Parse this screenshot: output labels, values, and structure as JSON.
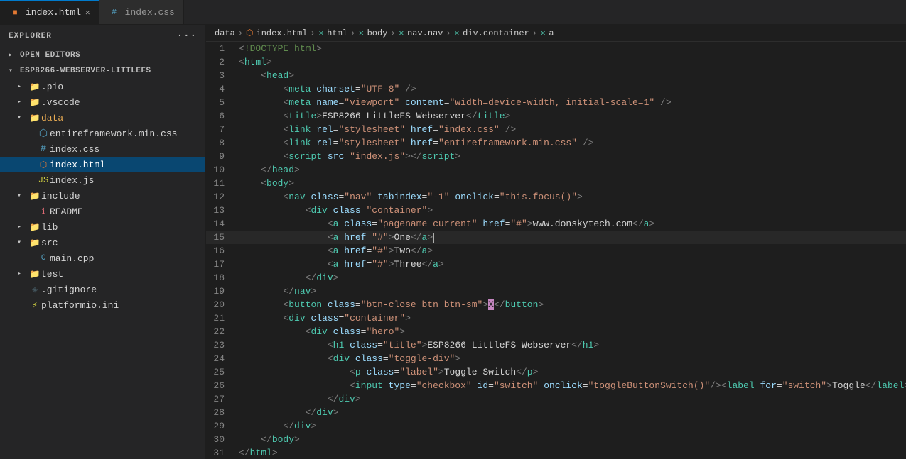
{
  "tabs": [
    {
      "label": "index.html",
      "type": "html",
      "active": true,
      "id": "tab-indexhtml"
    },
    {
      "label": "index.css",
      "type": "css",
      "active": false,
      "id": "tab-indexcss"
    }
  ],
  "breadcrumb": {
    "items": [
      "data",
      "index.html",
      "html",
      "body",
      "nav.nav",
      "div.container",
      "a"
    ]
  },
  "sidebar": {
    "title": "EXPLORER",
    "openEditors": "OPEN EDITORS",
    "projectRoot": "ESP8266-WEBSERVER-LITTLEFS",
    "files": [
      {
        "id": "pio",
        "label": ".pio",
        "type": "folder",
        "indent": 1,
        "expanded": false
      },
      {
        "id": "vscode",
        "label": ".vscode",
        "type": "folder",
        "indent": 1,
        "expanded": false
      },
      {
        "id": "data",
        "label": "data",
        "type": "folder",
        "indent": 1,
        "expanded": true
      },
      {
        "id": "entireframework",
        "label": "entireframework.min.css",
        "type": "css",
        "indent": 2
      },
      {
        "id": "indexcss",
        "label": "index.css",
        "type": "css",
        "indent": 2
      },
      {
        "id": "indexhtml",
        "label": "index.html",
        "type": "html",
        "indent": 2,
        "active": true
      },
      {
        "id": "indexjs",
        "label": "index.js",
        "type": "js",
        "indent": 2
      },
      {
        "id": "include",
        "label": "include",
        "type": "folder",
        "indent": 1,
        "expanded": true
      },
      {
        "id": "readme",
        "label": "README",
        "type": "readme",
        "indent": 2
      },
      {
        "id": "lib",
        "label": "lib",
        "type": "folder",
        "indent": 1,
        "expanded": false
      },
      {
        "id": "src",
        "label": "src",
        "type": "folder",
        "indent": 1,
        "expanded": true
      },
      {
        "id": "maincpp",
        "label": "main.cpp",
        "type": "cpp",
        "indent": 2
      },
      {
        "id": "test",
        "label": "test",
        "type": "folder",
        "indent": 1,
        "expanded": false
      },
      {
        "id": "gitignore",
        "label": ".gitignore",
        "type": "gitignore",
        "indent": 1
      },
      {
        "id": "platformio",
        "label": "platformio.ini",
        "type": "ini",
        "indent": 1
      }
    ]
  },
  "code": {
    "lines": [
      {
        "num": 1,
        "html": "<span class='t-bracket'>&lt;</span><span class='t-doctype'>!DOCTYPE html</span><span class='t-bracket'>&gt;</span>"
      },
      {
        "num": 2,
        "html": "<span class='t-bracket'>&lt;</span><span class='t-tag'>html</span><span class='t-bracket'>&gt;</span>"
      },
      {
        "num": 3,
        "html": "    <span class='t-bracket'>&lt;</span><span class='t-tag'>head</span><span class='t-bracket'>&gt;</span>"
      },
      {
        "num": 4,
        "html": "        <span class='t-bracket'>&lt;</span><span class='t-tag'>meta</span> <span class='t-attr'>charset</span><span class='t-eq'>=</span><span class='t-val'>\"UTF-8\"</span> <span class='t-bracket'>/&gt;</span>"
      },
      {
        "num": 5,
        "html": "        <span class='t-bracket'>&lt;</span><span class='t-tag'>meta</span> <span class='t-attr'>name</span><span class='t-eq'>=</span><span class='t-val'>\"viewport\"</span> <span class='t-attr'>content</span><span class='t-eq'>=</span><span class='t-val'>\"width=device-width, initial-scale=1\"</span> <span class='t-bracket'>/&gt;</span>"
      },
      {
        "num": 6,
        "html": "        <span class='t-bracket'>&lt;</span><span class='t-tag'>title</span><span class='t-bracket'>&gt;</span><span class='t-text'>ESP8266 LittleFS Webserver</span><span class='t-bracket'>&lt;/</span><span class='t-tag'>title</span><span class='t-bracket'>&gt;</span>"
      },
      {
        "num": 7,
        "html": "        <span class='t-bracket'>&lt;</span><span class='t-tag'>link</span> <span class='t-attr'>rel</span><span class='t-eq'>=</span><span class='t-val'>\"stylesheet\"</span> <span class='t-attr'>href</span><span class='t-eq'>=</span><span class='t-val'>\"index.css\"</span> <span class='t-bracket'>/&gt;</span>"
      },
      {
        "num": 8,
        "html": "        <span class='t-bracket'>&lt;</span><span class='t-tag'>link</span> <span class='t-attr'>rel</span><span class='t-eq'>=</span><span class='t-val'>\"stylesheet\"</span> <span class='t-attr'>href</span><span class='t-eq'>=</span><span class='t-val'>\"entireframework.min.css\"</span> <span class='t-bracket'>/&gt;</span>"
      },
      {
        "num": 9,
        "html": "        <span class='t-bracket'>&lt;</span><span class='t-tag'>script</span> <span class='t-attr'>src</span><span class='t-eq'>=</span><span class='t-val'>\"index.js\"</span><span class='t-bracket'>&gt;&lt;/</span><span class='t-tag'>script</span><span class='t-bracket'>&gt;</span>"
      },
      {
        "num": 10,
        "html": "    <span class='t-bracket'>&lt;/</span><span class='t-tag'>head</span><span class='t-bracket'>&gt;</span>"
      },
      {
        "num": 11,
        "html": "    <span class='t-bracket'>&lt;</span><span class='t-tag'>body</span><span class='t-bracket'>&gt;</span>"
      },
      {
        "num": 12,
        "html": "        <span class='t-bracket'>&lt;</span><span class='t-tag'>nav</span> <span class='t-attr'>class</span><span class='t-eq'>=</span><span class='t-val'>\"nav\"</span> <span class='t-attr'>tabindex</span><span class='t-eq'>=</span><span class='t-val'>\"-1\"</span> <span class='t-attr'>onclick</span><span class='t-eq'>=</span><span class='t-val'>\"this.focus()\"</span><span class='t-bracket'>&gt;</span>"
      },
      {
        "num": 13,
        "html": "            <span class='t-bracket'>&lt;</span><span class='t-tag'>div</span> <span class='t-attr'>class</span><span class='t-eq'>=</span><span class='t-val'>\"container\"</span><span class='t-bracket'>&gt;</span>"
      },
      {
        "num": 14,
        "html": "                <span class='t-bracket'>&lt;</span><span class='t-tag'>a</span> <span class='t-attr'>class</span><span class='t-eq'>=</span><span class='t-val'>\"pagename current\"</span> <span class='t-attr'>href</span><span class='t-eq'>=</span><span class='t-val'>\"#\"</span><span class='t-bracket'>&gt;</span><span class='t-text'>www.donskytech.com</span><span class='t-bracket'>&lt;/</span><span class='t-tag'>a</span><span class='t-bracket'>&gt;</span>"
      },
      {
        "num": 15,
        "html": "                <span class='t-bracket'>&lt;</span><span class='t-tag'>a</span> <span class='t-attr'>href</span><span class='t-eq'>=</span><span class='t-val'>\"#\"</span><span class='t-bracket'>&gt;</span><span class='t-text'>One</span><span class='t-bracket'>&lt;/</span><span class='t-tag'>a</span><span class='t-bracket'>&gt;</span>",
        "cursor": true
      },
      {
        "num": 16,
        "html": "                <span class='t-bracket'>&lt;</span><span class='t-tag'>a</span> <span class='t-attr'>href</span><span class='t-eq'>=</span><span class='t-val'>\"#\"</span><span class='t-bracket'>&gt;</span><span class='t-text'>Two</span><span class='t-bracket'>&lt;/</span><span class='t-tag'>a</span><span class='t-bracket'>&gt;</span>"
      },
      {
        "num": 17,
        "html": "                <span class='t-bracket'>&lt;</span><span class='t-tag'>a</span> <span class='t-attr'>href</span><span class='t-eq'>=</span><span class='t-val'>\"#\"</span><span class='t-bracket'>&gt;</span><span class='t-text'>Three</span><span class='t-bracket'>&lt;/</span><span class='t-tag'>a</span><span class='t-bracket'>&gt;</span>"
      },
      {
        "num": 18,
        "html": "            <span class='t-bracket'>&lt;/</span><span class='t-tag'>div</span><span class='t-bracket'>&gt;</span>"
      },
      {
        "num": 19,
        "html": "        <span class='t-bracket'>&lt;/</span><span class='t-tag'>nav</span><span class='t-bracket'>&gt;</span>"
      },
      {
        "num": 20,
        "html": "        <span class='t-bracket'>&lt;</span><span class='t-tag'>button</span> <span class='t-attr'>class</span><span class='t-eq'>=</span><span class='t-val'>\"btn-close btn btn-sm\"</span><span class='t-bracket'>&gt;</span><span style='background:#c586c0;color:#1e1e1e;'>X</span><span class='t-bracket'>&lt;/</span><span class='t-tag'>button</span><span class='t-bracket'>&gt;</span>"
      },
      {
        "num": 21,
        "html": "        <span class='t-bracket'>&lt;</span><span class='t-tag'>div</span> <span class='t-attr'>class</span><span class='t-eq'>=</span><span class='t-val'>\"container\"</span><span class='t-bracket'>&gt;</span>"
      },
      {
        "num": 22,
        "html": "            <span class='t-bracket'>&lt;</span><span class='t-tag'>div</span> <span class='t-attr'>class</span><span class='t-eq'>=</span><span class='t-val'>\"hero\"</span><span class='t-bracket'>&gt;</span>"
      },
      {
        "num": 23,
        "html": "                <span class='t-bracket'>&lt;</span><span class='t-tag'>h1</span> <span class='t-attr'>class</span><span class='t-eq'>=</span><span class='t-val'>\"title\"</span><span class='t-bracket'>&gt;</span><span class='t-text'>ESP8266 LittleFS Webserver</span><span class='t-bracket'>&lt;/</span><span class='t-tag'>h1</span><span class='t-bracket'>&gt;</span>"
      },
      {
        "num": 24,
        "html": "                <span class='t-bracket'>&lt;</span><span class='t-tag'>div</span> <span class='t-attr'>class</span><span class='t-eq'>=</span><span class='t-val'>\"toggle-div\"</span><span class='t-bracket'>&gt;</span>"
      },
      {
        "num": 25,
        "html": "                    <span class='t-bracket'>&lt;</span><span class='t-tag'>p</span> <span class='t-attr'>class</span><span class='t-eq'>=</span><span class='t-val'>\"label\"</span><span class='t-bracket'>&gt;</span><span class='t-text'>Toggle Switch</span><span class='t-bracket'>&lt;/</span><span class='t-tag'>p</span><span class='t-bracket'>&gt;</span>"
      },
      {
        "num": 26,
        "html": "                    <span class='t-bracket'>&lt;</span><span class='t-tag'>input</span> <span class='t-attr'>type</span><span class='t-eq'>=</span><span class='t-val'>\"checkbox\"</span> <span class='t-attr'>id</span><span class='t-eq'>=</span><span class='t-val'>\"switch\"</span> <span class='t-attr'>onclick</span><span class='t-eq'>=</span><span class='t-val'>\"toggleButtonSwitch()\"</span><span class='t-bracket'>/&gt;&lt;</span><span class='t-tag'>label</span> <span class='t-attr'>for</span><span class='t-eq'>=</span><span class='t-val'>\"switch\"</span><span class='t-bracket'>&gt;</span><span class='t-text'>Toggle</span><span class='t-bracket'>&lt;/</span><span class='t-tag'>label</span><span class='t-bracket'>&gt;</span>"
      },
      {
        "num": 27,
        "html": "                <span class='t-bracket'>&lt;/</span><span class='t-tag'>div</span><span class='t-bracket'>&gt;</span>"
      },
      {
        "num": 28,
        "html": "            <span class='t-bracket'>&lt;/</span><span class='t-tag'>div</span><span class='t-bracket'>&gt;</span>"
      },
      {
        "num": 29,
        "html": "        <span class='t-bracket'>&lt;/</span><span class='t-tag'>div</span><span class='t-bracket'>&gt;</span>"
      },
      {
        "num": 30,
        "html": "    <span class='t-bracket'>&lt;/</span><span class='t-tag'>body</span><span class='t-bracket'>&gt;</span>"
      },
      {
        "num": 31,
        "html": "<span class='t-bracket'>&lt;/</span><span class='t-tag'>html</span><span class='t-bracket'>&gt;</span>"
      }
    ]
  }
}
